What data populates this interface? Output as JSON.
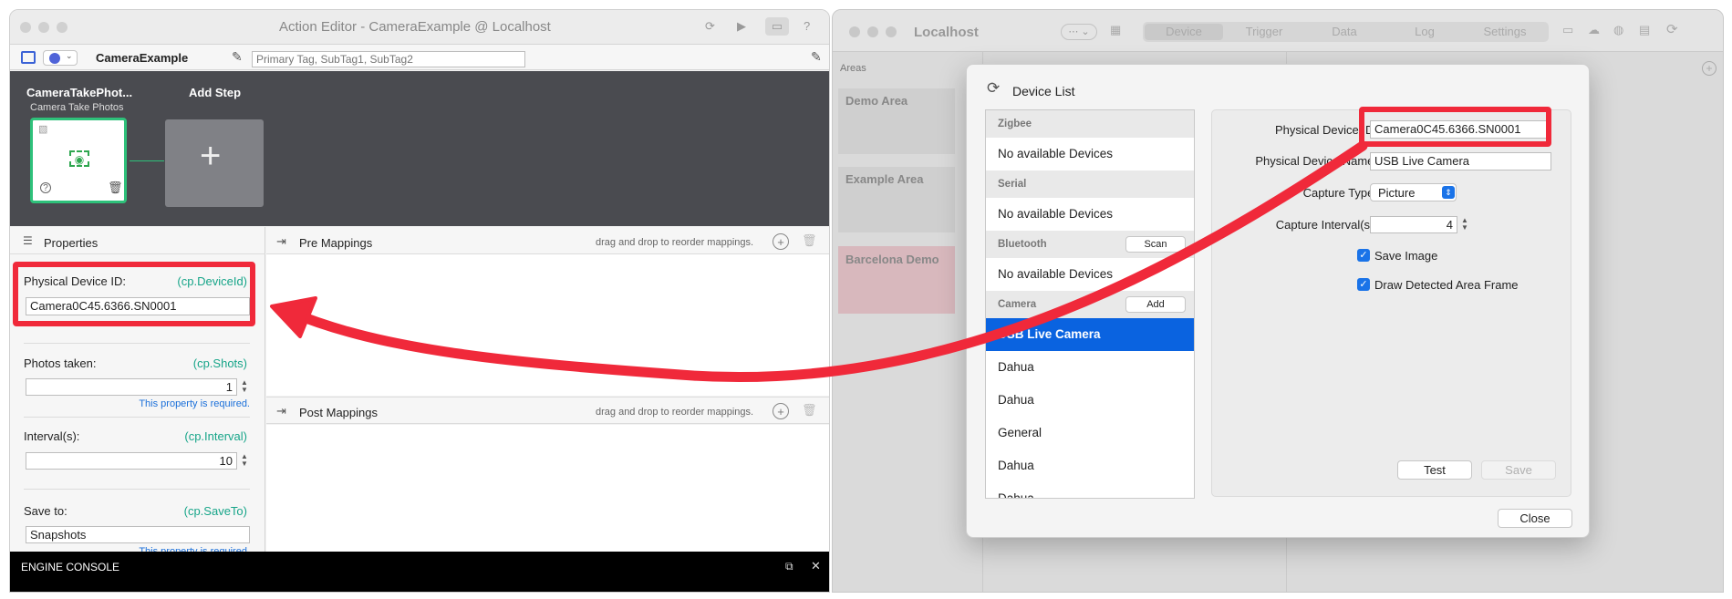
{
  "action_editor": {
    "title": "Action Editor - CameraExample @ Localhost",
    "action_name": "CameraExample",
    "tags_placeholder": "Primary Tag, SubTag1, SubTag2",
    "step": {
      "title": "CameraTakePhot...",
      "subtitle": "Camera Take Photos"
    },
    "add_step_label": "Add Step",
    "properties_label": "Properties",
    "pre_mappings_label": "Pre Mappings",
    "post_mappings_label": "Post Mappings",
    "mappings_hint": "drag and drop to reorder mappings.",
    "fields": [
      {
        "label": "Physical Device ID:",
        "tag": "(cp.DeviceId)",
        "value": "Camera0C45.6366.SN0001",
        "required": ""
      },
      {
        "label": "Photos taken:",
        "tag": "(cp.Shots)",
        "value": "1",
        "required": "This property is required."
      },
      {
        "label": "Interval(s):",
        "tag": "(cp.Interval)",
        "value": "10",
        "required": ""
      },
      {
        "label": "Save to:",
        "tag": "(cp.SaveTo)",
        "value": "Snapshots",
        "required": "This property is required."
      }
    ],
    "console_label": "ENGINE CONSOLE"
  },
  "localhost": {
    "title": "Localhost",
    "tabs": [
      "Device",
      "Trigger",
      "Data",
      "Log",
      "Settings"
    ],
    "areas_label": "Areas",
    "areas": [
      "Demo Area",
      "Example Area",
      "Barcelona Demo"
    ]
  },
  "device_list": {
    "title": "Device List",
    "groups": [
      {
        "name": "Zigbee",
        "button": "",
        "items": [
          "No available Devices"
        ]
      },
      {
        "name": "Serial",
        "button": "",
        "items": [
          "No available Devices"
        ]
      },
      {
        "name": "Bluetooth",
        "button": "Scan",
        "items": [
          "No available Devices"
        ]
      },
      {
        "name": "Camera",
        "button": "Add",
        "items": [
          "USB  Live  Camera",
          "Dahua",
          "Dahua",
          "General",
          "Dahua",
          "Dahua"
        ]
      }
    ],
    "selected_item": "USB  Live  Camera",
    "detail": {
      "device_id_label": "Physical Device ID:",
      "device_id_value": "Camera0C45.6366.SN0001",
      "device_name_label": "Physical Device Name:",
      "device_name_value": "USB  Live  Camera",
      "capture_type_label": "Capture Type:",
      "capture_type_value": "Picture",
      "capture_interval_label": "Capture Interval(s):",
      "capture_interval_value": "4",
      "save_image_label": "Save Image",
      "draw_frame_label": "Draw Detected Area Frame"
    },
    "test_label": "Test",
    "save_label": "Save",
    "close_label": "Close"
  },
  "colors": {
    "highlight": "#f0293a",
    "selection": "#0a63e0",
    "tag_green": "#17a589",
    "step_border": "#2ec17a"
  }
}
